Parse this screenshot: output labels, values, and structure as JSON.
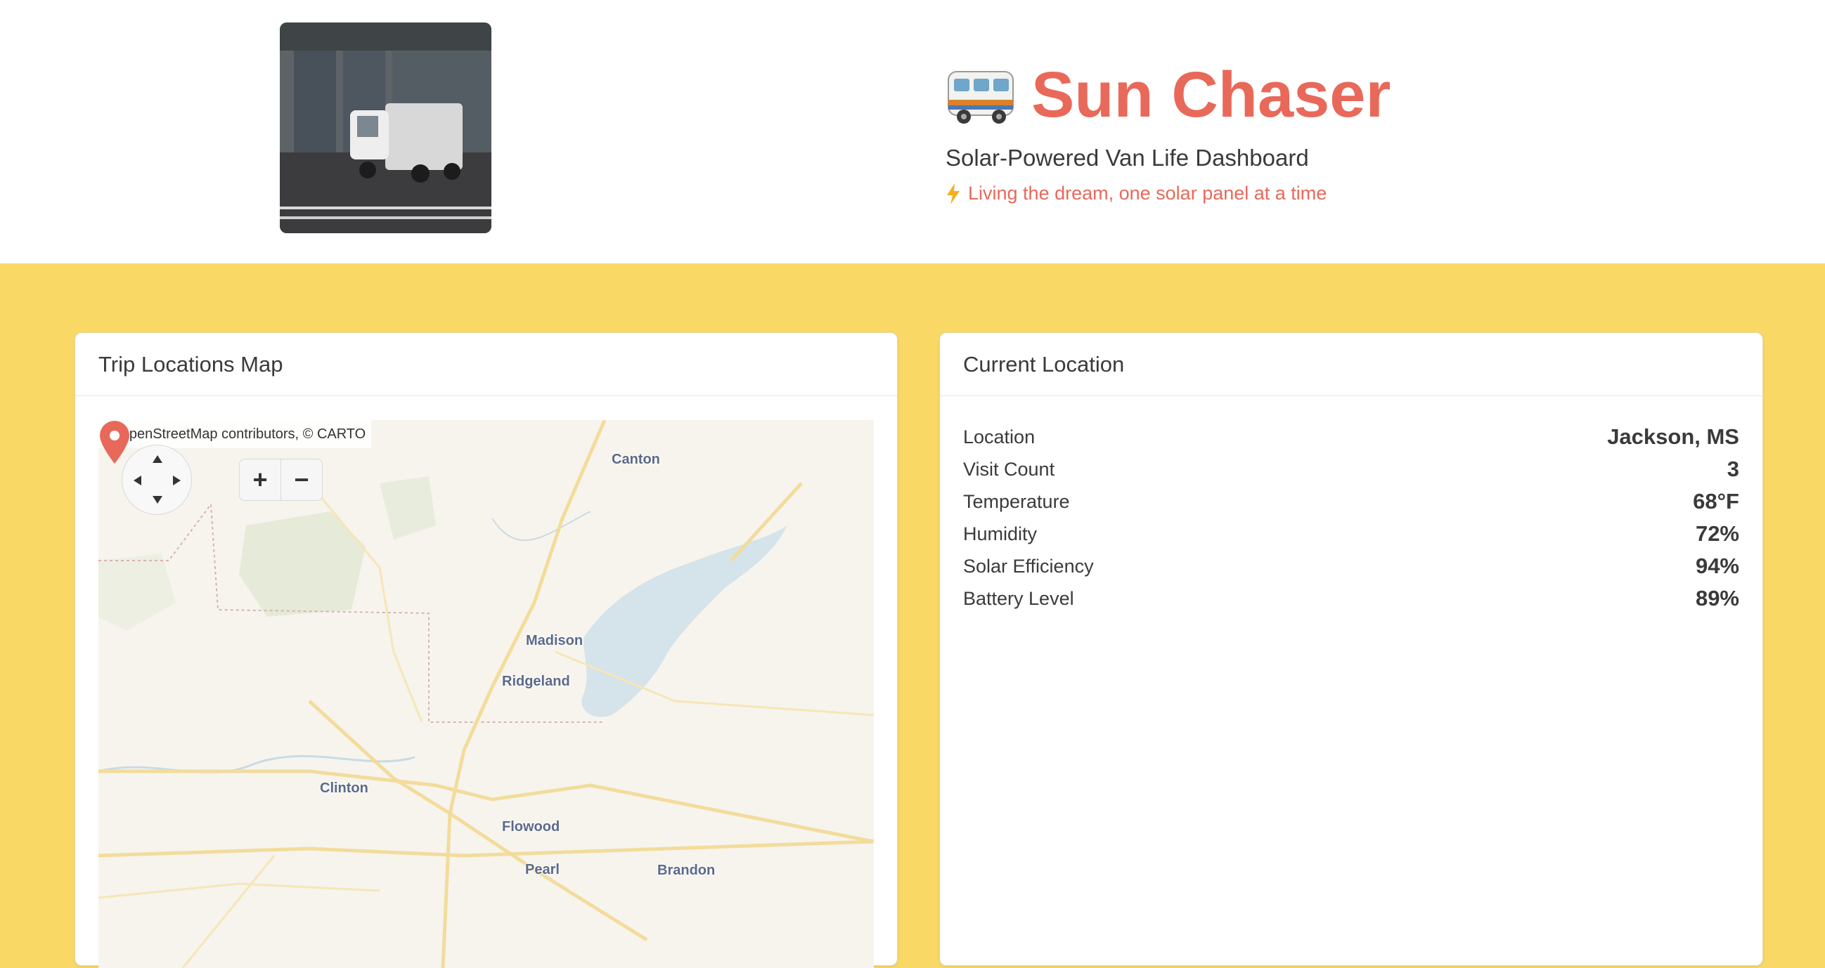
{
  "header": {
    "title": "Sun Chaser",
    "subtitle": "Solar-Powered Van Life Dashboard",
    "tagline": "Living the dream, one solar panel at a time",
    "accent_color": "#e8695a",
    "background_color": "#f9d866"
  },
  "map_card": {
    "title": "Trip Locations Map",
    "attribution": "© OpenStreetMap contributors, © CARTO",
    "zoom_in": "+",
    "zoom_out": "−",
    "places": [
      "Canton",
      "Madison",
      "Ridgeland",
      "Clinton",
      "Flowood",
      "Pearl",
      "Brandon"
    ]
  },
  "location_card": {
    "title": "Current Location",
    "rows": [
      {
        "label": "Location",
        "value": "Jackson, MS"
      },
      {
        "label": "Visit Count",
        "value": "3"
      },
      {
        "label": "Temperature",
        "value": "68°F"
      },
      {
        "label": "Humidity",
        "value": "72%"
      },
      {
        "label": "Solar Efficiency",
        "value": "94%"
      },
      {
        "label": "Battery Level",
        "value": "89%"
      }
    ]
  }
}
